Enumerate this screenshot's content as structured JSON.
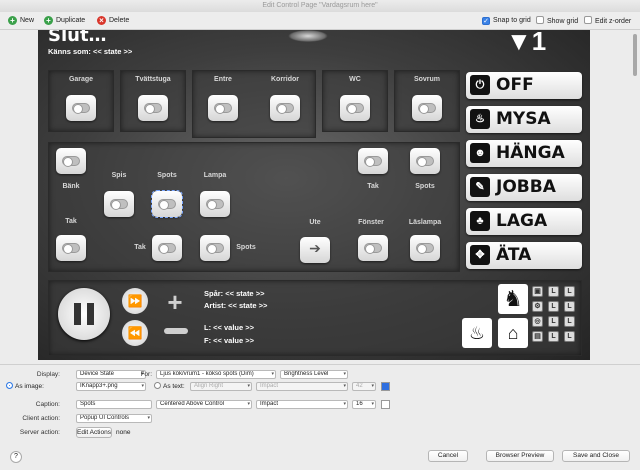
{
  "window": {
    "title": "Edit Control Page \"Vardagsrum here\""
  },
  "toolbar": {
    "new_label": "New",
    "duplicate_label": "Duplicate",
    "delete_label": "Delete",
    "snap_to_grid": "Snap to grid",
    "show_grid": "Show grid",
    "edit_z_order": "Edit z-order",
    "snap_checked": true
  },
  "canvas": {
    "header_text": "Känns som: << state >>",
    "top_rooms": [
      {
        "label": "Garage"
      },
      {
        "label": "Tvättstuga"
      },
      {
        "label": "Entre"
      },
      {
        "label": "Korridor"
      },
      {
        "label": "WC"
      },
      {
        "label": "Sovrum"
      }
    ],
    "kitchen": {
      "benk": "Bänk",
      "spis": "Spis",
      "spots": "Spots",
      "lampa": "Lampa",
      "tak_left": "Tak",
      "tak_mid": "Tak",
      "spots_low": "Spots"
    },
    "living": {
      "tak": "Tak",
      "spots": "Spots",
      "ute": "Ute",
      "fonster": "Fönster",
      "laslampa": "Läslampa"
    },
    "scenes": [
      {
        "icon": "power-icon",
        "glyph": "⏻",
        "label": "OFF"
      },
      {
        "icon": "candle-icon",
        "glyph": "♨",
        "label": "MYSA"
      },
      {
        "icon": "smiley-icon",
        "glyph": "☻",
        "label": "HÄNGA"
      },
      {
        "icon": "pencil-icon",
        "glyph": "✎",
        "label": "JOBBA"
      },
      {
        "icon": "flame-icon",
        "glyph": "♣",
        "label": "LAGA"
      },
      {
        "icon": "cutlery-icon",
        "glyph": "✥",
        "label": "ÄTA"
      }
    ],
    "media": {
      "track": "Spår: << state >>",
      "artist": "Artist: << state >>",
      "left_level": "L: << value >>",
      "front_level": "F: << value >>"
    }
  },
  "props": {
    "display_label": "Display:",
    "display_value": "Device State",
    "for_label": "For:",
    "for_value": "Ljus kök/vrum1 - köksö spots (Dim)",
    "for_state": "Brightness Level",
    "as_image_label": "As image:",
    "as_image_value": "IKnapp3+.png",
    "as_text_label": "As text:",
    "as_text_align": "Align Right",
    "as_text_font": "Impact",
    "as_text_size": "42",
    "caption_label": "Caption:",
    "caption_value": "Spots",
    "caption_pos": "Centered Above Control",
    "caption_font": "Impact",
    "caption_size": "16",
    "client_action_label": "Client action:",
    "client_action_value": "Popup UI Controls",
    "server_action_label": "Server action:",
    "server_action_button": "Edit Actions",
    "server_action_value": "none",
    "cancel": "Cancel",
    "browser_preview": "Browser Preview",
    "save_close": "Save and Close",
    "help": "?",
    "accent": "#2f7ae5"
  }
}
